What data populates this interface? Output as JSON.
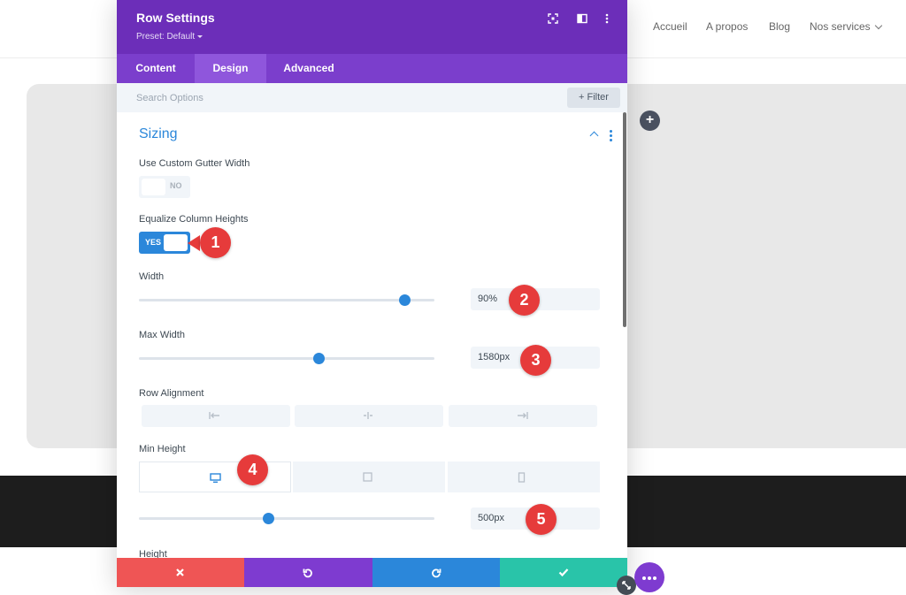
{
  "site": {
    "nav": [
      "Accueil",
      "A propos",
      "Blog",
      "Nos services"
    ]
  },
  "modal": {
    "title": "Row Settings",
    "preset": "Preset: Default",
    "tabs": [
      {
        "label": "Content",
        "active": false
      },
      {
        "label": "Design",
        "active": true
      },
      {
        "label": "Advanced",
        "active": false
      }
    ],
    "search_placeholder": "Search Options",
    "filter_label": "+ Filter",
    "section_title": "Sizing",
    "fields": {
      "custom_gutter": {
        "label": "Use Custom Gutter Width",
        "state": "NO"
      },
      "equalize": {
        "label": "Equalize Column Heights",
        "state": "YES"
      },
      "width": {
        "label": "Width",
        "value": "90%",
        "slider_fraction": 0.9
      },
      "max_width": {
        "label": "Max Width",
        "value": "1580px",
        "slider_fraction": 0.61
      },
      "row_alignment": {
        "label": "Row Alignment",
        "options": [
          "align-left-icon",
          "align-center-icon",
          "align-right-icon"
        ]
      },
      "min_height": {
        "label": "Min Height",
        "devices": [
          "desktop-icon",
          "tablet-icon",
          "phone-icon"
        ],
        "active_device": "desktop",
        "value": "500px",
        "slider_fraction": 0.44
      },
      "height": {
        "label": "Height"
      }
    },
    "actions": [
      "close-icon",
      "undo-icon",
      "redo-icon",
      "check-icon"
    ]
  },
  "annotations": [
    "1",
    "2",
    "3",
    "4",
    "5"
  ],
  "colors": {
    "header_purple": "#6c2eb9",
    "tabs_purple": "#7b3ecc",
    "accent_blue": "#2b87da",
    "cancel_red": "#ef5555",
    "undo_purple": "#7e3bd0",
    "redo_blue": "#2b87da",
    "save_green": "#29c4a9",
    "marker_red": "#e63b3b"
  }
}
